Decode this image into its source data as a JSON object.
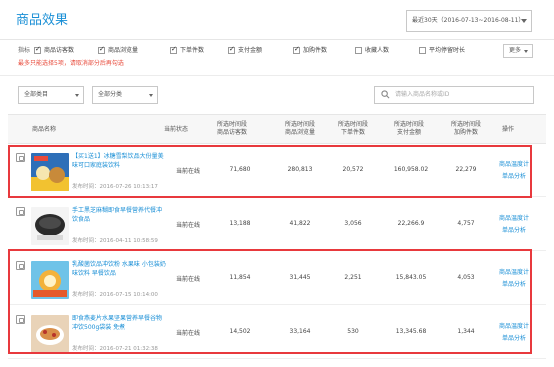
{
  "header": {
    "title": "商品效果",
    "date_range": "最近30天（2016-07-13~2016-08-11）"
  },
  "metrics": {
    "label": "指标",
    "items": [
      {
        "label": "商品访客数",
        "checked": true
      },
      {
        "label": "商品浏览量",
        "checked": true
      },
      {
        "label": "下单件数",
        "checked": true
      },
      {
        "label": "支付金额",
        "checked": true
      },
      {
        "label": "加购件数",
        "checked": true
      },
      {
        "label": "收藏人数",
        "checked": false
      },
      {
        "label": "平均停留时长",
        "checked": false
      }
    ],
    "warning": "最多只能选择5项，请取消部分后再勾选",
    "more_label": "更多"
  },
  "filters": {
    "category": "全部类目",
    "type": "全部分类",
    "search_placeholder": "请输入商品名称或ID"
  },
  "table": {
    "headers": {
      "name": "商品名称",
      "status": "当前状态",
      "visitors": "所选时间段\n商品访客数",
      "views": "所选时间段\n商品浏览量",
      "orders": "所选时间段\n下单件数",
      "payment": "所选时间段\n支付金额",
      "cart": "所选时间段\n加购件数",
      "ops": "操作"
    },
    "rows": [
      {
        "title": "【买1送1】冰糖雪梨饮品大份量美味可口家庭装饮料",
        "published": "发布时间：2016-07-26 10:13:17",
        "status": "当前在线",
        "visitors": "71,680",
        "views": "280,813",
        "orders": "20,572",
        "payment": "160,958.02",
        "cart": "22,279",
        "op1": "商品温度计",
        "op2": "单品分析"
      },
      {
        "title": "手工黑芝麻糊即食早餐营养代餐冲饮食品",
        "published": "发布时间：2016-04-11 10:58:59",
        "status": "当前在线",
        "visitors": "13,188",
        "views": "41,822",
        "orders": "3,056",
        "payment": "22,266.9",
        "cart": "4,757",
        "op1": "商品温度计",
        "op2": "单品分析"
      },
      {
        "title": "乳酸菌饮品冲饮粉 水果味 小包装奶味饮料 早餐饮品",
        "published": "发布时间：2016-07-15 10:14:00",
        "status": "当前在线",
        "visitors": "11,854",
        "views": "31,445",
        "orders": "2,251",
        "payment": "15,843.05",
        "cart": "4,053",
        "op1": "商品温度计",
        "op2": "单品分析"
      },
      {
        "title": "即食燕麦片水果坚果营养早餐谷物冲饮500g袋装 免煮",
        "published": "发布时间：2016-07-21 01:32:38",
        "status": "当前在线",
        "visitors": "14,502",
        "views": "33,164",
        "orders": "530",
        "payment": "13,345.68",
        "cart": "1,344",
        "op1": "商品温度计",
        "op2": "单品分析"
      }
    ]
  },
  "colors": {
    "accent": "#1a8fd6",
    "highlight": "#e8393d",
    "warning": "#e84c3d"
  }
}
